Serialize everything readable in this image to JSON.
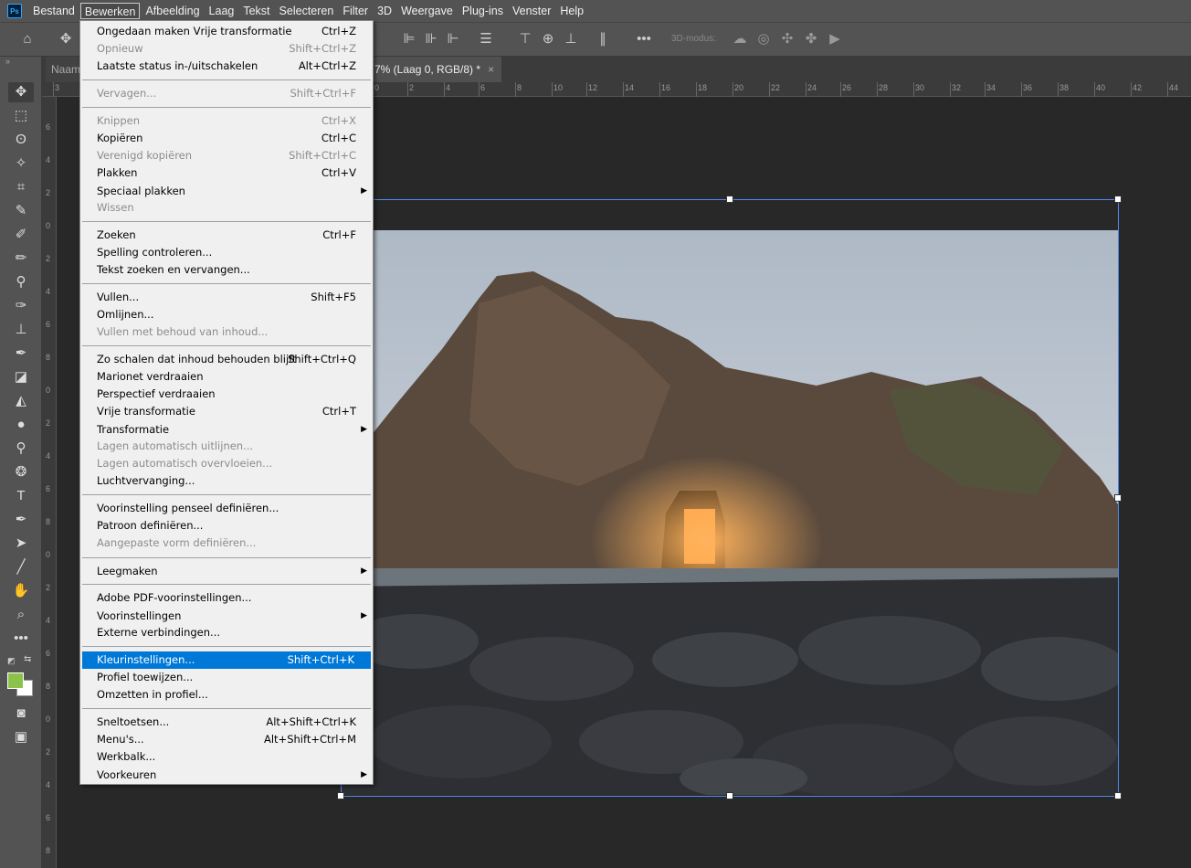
{
  "menubar": {
    "logo": "Ps",
    "items": [
      "Bestand",
      "Bewerken",
      "Afbeelding",
      "Laag",
      "Tekst",
      "Selecteren",
      "Filter",
      "3D",
      "Weergave",
      "Plug-ins",
      "Venster",
      "Help"
    ],
    "active_index": 1
  },
  "optionsbar": {
    "threed_label": "3D-modus:"
  },
  "tabs": {
    "first": "Naam",
    "active": "7% (Laag 0, RGB/8) *",
    "close": "×"
  },
  "ruler_top": [
    "3",
    "0",
    "2",
    "4",
    "6",
    "8",
    "10",
    "12",
    "14",
    "16",
    "18",
    "20",
    "22",
    "24",
    "26",
    "28",
    "30",
    "32",
    "34",
    "36",
    "38",
    "40",
    "42",
    "44"
  ],
  "ruler_left": [
    "6",
    "4",
    "2",
    "0",
    "2",
    "4",
    "6",
    "8",
    "0",
    "2",
    "4",
    "6",
    "8",
    "0",
    "2",
    "4",
    "6",
    "8",
    "0",
    "2",
    "4",
    "6",
    "8"
  ],
  "colors": {
    "foreground": "#8bc34a",
    "background": "#ffffff",
    "highlight": "#0078d7"
  },
  "edit_menu": {
    "items": [
      {
        "label": "Ongedaan maken Vrije transformatie",
        "shortcut": "Ctrl+Z",
        "disabled": false
      },
      {
        "label": "Opnieuw",
        "shortcut": "Shift+Ctrl+Z",
        "disabled": true
      },
      {
        "label": "Laatste status in-/uitschakelen",
        "shortcut": "Alt+Ctrl+Z",
        "disabled": false
      },
      {
        "label": "Vervagen...",
        "shortcut": "Shift+Ctrl+F",
        "disabled": true
      },
      {
        "label": "Knippen",
        "shortcut": "Ctrl+X",
        "disabled": true
      },
      {
        "label": "Kopiëren",
        "shortcut": "Ctrl+C",
        "disabled": false
      },
      {
        "label": "Verenigd kopiëren",
        "shortcut": "Shift+Ctrl+C",
        "disabled": true
      },
      {
        "label": "Plakken",
        "shortcut": "Ctrl+V",
        "disabled": false
      },
      {
        "label": "Speciaal plakken",
        "shortcut": "",
        "disabled": false,
        "submenu": true
      },
      {
        "label": "Wissen",
        "shortcut": "",
        "disabled": true
      },
      {
        "label": "Zoeken",
        "shortcut": "Ctrl+F",
        "disabled": false
      },
      {
        "label": "Spelling controleren...",
        "shortcut": "",
        "disabled": false
      },
      {
        "label": "Tekst zoeken en vervangen...",
        "shortcut": "",
        "disabled": false
      },
      {
        "label": "Vullen...",
        "shortcut": "Shift+F5",
        "disabled": false
      },
      {
        "label": "Omlijnen...",
        "shortcut": "",
        "disabled": false
      },
      {
        "label": "Vullen met behoud van inhoud...",
        "shortcut": "",
        "disabled": true
      },
      {
        "label": "Zo schalen dat inhoud behouden blijft",
        "shortcut": "Shift+Ctrl+Q",
        "disabled": false
      },
      {
        "label": "Marionet verdraaien",
        "shortcut": "",
        "disabled": false
      },
      {
        "label": "Perspectief verdraaien",
        "shortcut": "",
        "disabled": false
      },
      {
        "label": "Vrije transformatie",
        "shortcut": "Ctrl+T",
        "disabled": false
      },
      {
        "label": "Transformatie",
        "shortcut": "",
        "disabled": false,
        "submenu": true
      },
      {
        "label": "Lagen automatisch uitlijnen...",
        "shortcut": "",
        "disabled": true
      },
      {
        "label": "Lagen automatisch overvloeien...",
        "shortcut": "",
        "disabled": true
      },
      {
        "label": "Luchtvervanging...",
        "shortcut": "",
        "disabled": false
      },
      {
        "label": "Voorinstelling penseel definiëren...",
        "shortcut": "",
        "disabled": false
      },
      {
        "label": "Patroon definiëren...",
        "shortcut": "",
        "disabled": false
      },
      {
        "label": "Aangepaste vorm definiëren...",
        "shortcut": "",
        "disabled": true
      },
      {
        "label": "Leegmaken",
        "shortcut": "",
        "disabled": false,
        "submenu": true
      },
      {
        "label": "Adobe PDF-voorinstellingen...",
        "shortcut": "",
        "disabled": false
      },
      {
        "label": "Voorinstellingen",
        "shortcut": "",
        "disabled": false,
        "submenu": true
      },
      {
        "label": "Externe verbindingen...",
        "shortcut": "",
        "disabled": false
      },
      {
        "label": "Kleurinstellingen...",
        "shortcut": "Shift+Ctrl+K",
        "disabled": false,
        "highlighted": true
      },
      {
        "label": "Profiel toewijzen...",
        "shortcut": "",
        "disabled": false
      },
      {
        "label": "Omzetten in profiel...",
        "shortcut": "",
        "disabled": false
      },
      {
        "label": "Sneltoetsen...",
        "shortcut": "Alt+Shift+Ctrl+K",
        "disabled": false
      },
      {
        "label": "Menu's...",
        "shortcut": "Alt+Shift+Ctrl+M",
        "disabled": false
      },
      {
        "label": "Werkbalk...",
        "shortcut": "",
        "disabled": false
      },
      {
        "label": "Voorkeuren",
        "shortcut": "",
        "disabled": false,
        "submenu": true
      }
    ],
    "submenu_arrow": "▶"
  }
}
